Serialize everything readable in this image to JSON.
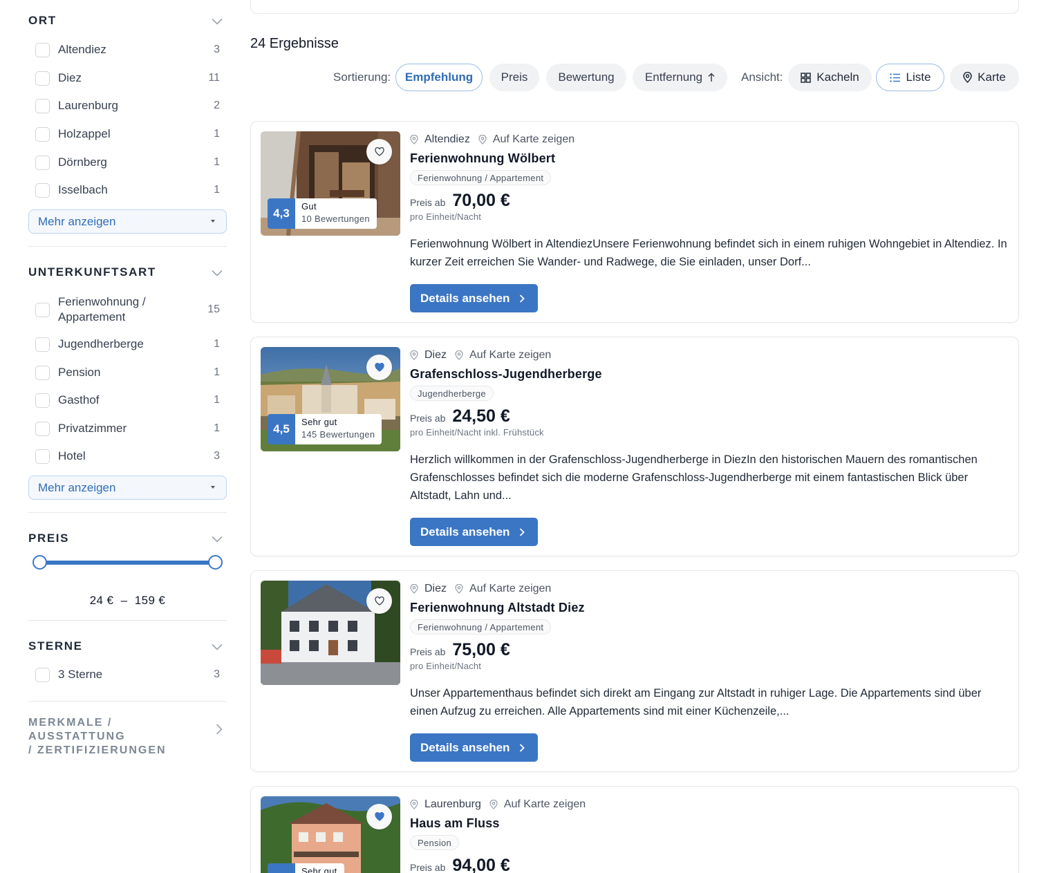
{
  "sidebar": {
    "ort": {
      "title": "ORT",
      "items": [
        {
          "label": "Altendiez",
          "count": "3"
        },
        {
          "label": "Diez",
          "count": "11"
        },
        {
          "label": "Laurenburg",
          "count": "2"
        },
        {
          "label": "Holzappel",
          "count": "1"
        },
        {
          "label": "Dörnberg",
          "count": "1"
        },
        {
          "label": "Isselbach",
          "count": "1"
        }
      ],
      "more_label": "Mehr anzeigen"
    },
    "unterkunftsart": {
      "title": "UNTERKUNFTSART",
      "items": [
        {
          "label": "Ferienwohnung /",
          "label2": "Appartement",
          "count": "15"
        },
        {
          "label": "Jugendherberge",
          "count": "1"
        },
        {
          "label": "Pension",
          "count": "1"
        },
        {
          "label": "Gasthof",
          "count": "1"
        },
        {
          "label": "Privatzimmer",
          "count": "1"
        },
        {
          "label": "Hotel",
          "count": "3"
        }
      ],
      "more_label": "Mehr anzeigen"
    },
    "preis": {
      "title": "PREIS",
      "range_text": "24 €  –  159 €",
      "min_fraction": 0,
      "max_fraction": 1
    },
    "sterne": {
      "title": "STERNE",
      "items": [
        {
          "label": "3 Sterne",
          "count": "3"
        }
      ]
    },
    "merkmale": {
      "title_line1": "MERKMALE / AUSSTATTUNG",
      "title_line2": "/ ZERTIFIZIERUNGEN"
    }
  },
  "main": {
    "results_count": "24 Ergebnisse",
    "sort_label": "Sortierung:",
    "sort_options": [
      "Empfehlung",
      "Preis",
      "Bewertung",
      "Entfernung"
    ],
    "view_label": "Ansicht:",
    "view_options": [
      "Kacheln",
      "Liste",
      "Karte"
    ],
    "map_link_label": "Auf Karte zeigen",
    "details_label": "Details ansehen",
    "price_prefix": "Preis ab",
    "cards": [
      {
        "location": "Altendiez",
        "title": "Ferienwohnung Wölbert",
        "type": "Ferienwohnung / Appartement",
        "price": "70,00 €",
        "price_unit": "pro Einheit/Nacht",
        "rating_score": "4,3",
        "rating_word": "Gut",
        "rating_count": "10 Bewertungen",
        "favorite": false,
        "description": "Ferienwohnung Wölbert in AltendiezUnsere Ferienwohnung befindet sich in einem ruhigen Wohngebiet in Altendiez. In kurzer Zeit erreichen Sie Wander- und Radwege, die Sie einladen, unser Dorf..."
      },
      {
        "location": "Diez",
        "title": "Grafenschloss-Jugendherberge",
        "type": "Jugendherberge",
        "price": "24,50 €",
        "price_unit": "pro Einheit/Nacht inkl. Frühstück",
        "rating_score": "4,5",
        "rating_word": "Sehr gut",
        "rating_count": "145 Bewertungen",
        "favorite": true,
        "description": "Herzlich willkommen in der Grafenschloss-Jugendherberge in DiezIn den historischen Mauern des romantischen Grafenschlosses befindet sich die moderne Grafenschloss-Jugendherberge mit einem fantastischen Blick über Altstadt, Lahn und..."
      },
      {
        "location": "Diez",
        "title": "Ferienwohnung Altstadt Diez",
        "type": "Ferienwohnung / Appartement",
        "price": "75,00 €",
        "price_unit": "pro Einheit/Nacht",
        "favorite": false,
        "description": "Unser Appartementhaus befindet sich direkt am Eingang zur Altstadt in ruhiger Lage. Die Appartements sind über einen Aufzug zu erreichen. Alle Appartements sind mit einer Küchenzeile,..."
      },
      {
        "location": "Laurenburg",
        "title": "Haus am Fluss",
        "type": "Pension",
        "price": "94,00 €",
        "rating_word": "Sehr gut",
        "favorite": true
      }
    ]
  },
  "colors": {
    "accent": "#3b76c4",
    "accent_text": "#2f6db5"
  }
}
